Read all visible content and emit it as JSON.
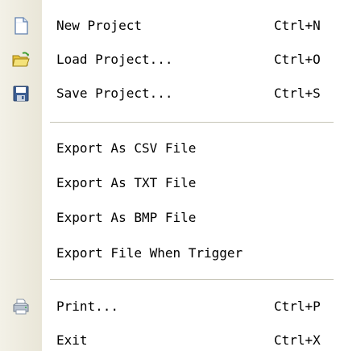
{
  "menu": {
    "items": [
      {
        "label": "New Project",
        "shortcut": "Ctrl+N",
        "icon": "new-document-icon"
      },
      {
        "label": "Load Project...",
        "shortcut": "Ctrl+O",
        "icon": "open-folder-icon"
      },
      {
        "label": "Save Project...",
        "shortcut": "Ctrl+S",
        "icon": "floppy-disk-icon"
      },
      {
        "label": "Export As CSV File",
        "shortcut": ""
      },
      {
        "label": "Export As TXT File",
        "shortcut": ""
      },
      {
        "label": "Export As BMP File",
        "shortcut": ""
      },
      {
        "label": "Export File When Trigger",
        "shortcut": ""
      },
      {
        "label": "Print...",
        "shortcut": "Ctrl+P",
        "icon": "printer-icon"
      },
      {
        "label": "Exit",
        "shortcut": "Ctrl+X"
      }
    ]
  }
}
